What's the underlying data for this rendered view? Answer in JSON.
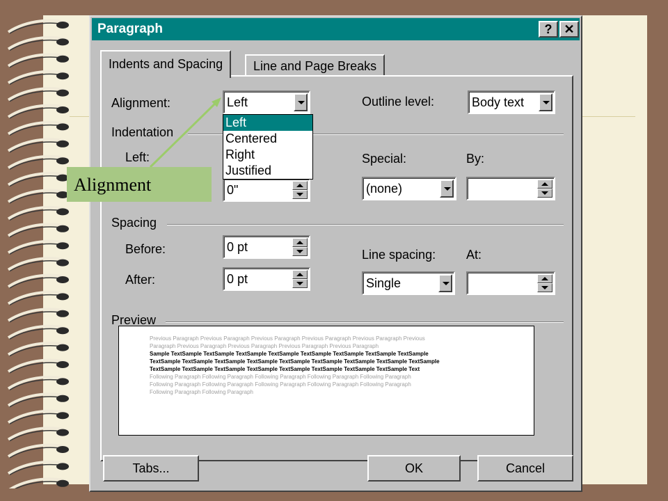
{
  "dialog": {
    "title": "Paragraph",
    "help_btn": "?",
    "close_btn": "✕"
  },
  "tabs": [
    {
      "label": "Indents and Spacing",
      "active": true
    },
    {
      "label": "Line and Page Breaks",
      "active": false
    }
  ],
  "general": {
    "alignment_label": "Alignment:",
    "alignment_value": "Left",
    "alignment_options": [
      "Left",
      "Centered",
      "Right",
      "Justified"
    ],
    "outline_label": "Outline level:",
    "outline_value": "Body text"
  },
  "indentation": {
    "group_label": "Indentation",
    "left_label": "Left:",
    "left_value": "0\"",
    "special_label": "Special:",
    "special_value": "(none)",
    "by_label": "By:",
    "by_value": ""
  },
  "spacing": {
    "group_label": "Spacing",
    "before_label": "Before:",
    "before_value": "0 pt",
    "after_label": "After:",
    "after_value": "0 pt",
    "line_spacing_label": "Line spacing:",
    "line_spacing_value": "Single",
    "at_label": "At:",
    "at_value": ""
  },
  "preview": {
    "group_label": "Preview",
    "lines": [
      {
        "text": "Previous Paragraph Previous Paragraph Previous Paragraph Previous Paragraph Previous Paragraph Previous",
        "style": "gray"
      },
      {
        "text": "Paragraph Previous Paragraph Previous Paragraph Previous Paragraph Previous Paragraph",
        "style": "gray"
      },
      {
        "text": "Sample TextSample TextSample TextSample TextSample TextSample TextSample TextSample TextSample",
        "style": "black"
      },
      {
        "text": "TextSample TextSample TextSample TextSample TextSample TextSample TextSample TextSample TextSample",
        "style": "black"
      },
      {
        "text": "TextSample TextSample TextSample TextSample TextSample TextSample TextSample TextSample Text",
        "style": "black"
      },
      {
        "text": "Following Paragraph Following Paragraph Following Paragraph Following Paragraph Following Paragraph",
        "style": "gray"
      },
      {
        "text": "Following Paragraph Following Paragraph Following Paragraph Following Paragraph Following Paragraph",
        "style": "gray"
      },
      {
        "text": "Following Paragraph Following Paragraph",
        "style": "gray"
      }
    ]
  },
  "buttons": {
    "tabs": "Tabs...",
    "ok": "OK",
    "cancel": "Cancel"
  },
  "callout": {
    "text": "Alignment"
  },
  "colors": {
    "titlebar": "#008080",
    "dialog_face": "#c0c0c0",
    "callout_bg": "#a7c884",
    "arrow": "#9ccc6a",
    "selection": "#008080"
  }
}
